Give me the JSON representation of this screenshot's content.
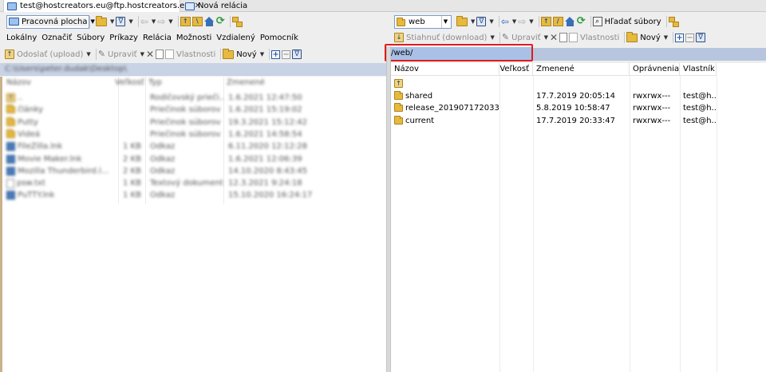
{
  "tabs": [
    {
      "label": "test@hostcreators.eu@ftp.hostcreators.eu",
      "close": "✕",
      "icon": "monitor-icon"
    },
    {
      "label": "Nová relácia",
      "icon": "new-session-icon"
    }
  ],
  "left_toolbar": {
    "location": "Pracovná plocha"
  },
  "menu": [
    "Lokálny",
    "Označiť",
    "Súbory",
    "Príkazy",
    "Relácia",
    "Možnosti",
    "Vzdialený",
    "Pomocník"
  ],
  "left_actions": {
    "upload": "Odoslať (upload)",
    "edit": "Upraviť",
    "properties": "Vlastnosti",
    "new": "Nový"
  },
  "right_toolbar": {
    "location": "web",
    "find_files": "Hľadať súbory"
  },
  "right_actions": {
    "download": "Stiahnuť (download)",
    "edit": "Upraviť",
    "properties": "Vlastnosti",
    "new": "Nový"
  },
  "left_panel": {
    "path": "C:\\Users\\peter.dudak\\Desktop\\",
    "columns": [
      "Názov",
      "Veľkosť",
      "Typ",
      "Zmenené"
    ],
    "rows": [
      {
        "name": "..",
        "size": "",
        "type": "Rodičovský prieči...",
        "modified": "1.6.2021  12:47:50",
        "icon": "updir"
      },
      {
        "name": "články",
        "size": "",
        "type": "Priečinok súborov",
        "modified": "1.6.2021  15:19:02",
        "icon": "folder"
      },
      {
        "name": "Putty",
        "size": "",
        "type": "Priečinok súborov",
        "modified": "19.3.2021  15:12:42",
        "icon": "folder"
      },
      {
        "name": "Videá",
        "size": "",
        "type": "Priečinok súborov",
        "modified": "1.6.2021  14:58:54",
        "icon": "folder"
      },
      {
        "name": "FileZilla.lnk",
        "size": "1 KB",
        "type": "Odkaz",
        "modified": "6.11.2020  12:12:28",
        "icon": "link"
      },
      {
        "name": "Movie Maker.lnk",
        "size": "2 KB",
        "type": "Odkaz",
        "modified": "1.6.2021  12:06:39",
        "icon": "link"
      },
      {
        "name": "Mozilla Thunderbird.l...",
        "size": "2 KB",
        "type": "Odkaz",
        "modified": "14.10.2020  8:43:45",
        "icon": "link"
      },
      {
        "name": "psw.txt",
        "size": "1 KB",
        "type": "Textový dokument",
        "modified": "12.3.2021  9:24:18",
        "icon": "doc"
      },
      {
        "name": "PuTTY.lnk",
        "size": "1 KB",
        "type": "Odkaz",
        "modified": "15.10.2020  16:24:17",
        "icon": "link"
      }
    ]
  },
  "right_panel": {
    "path": "/web/",
    "columns": [
      "Názov",
      "Veľkosť",
      "Zmenené",
      "Oprávnenia",
      "Vlastník"
    ],
    "rows": [
      {
        "name": "..",
        "size": "",
        "modified": "",
        "permissions": "",
        "owner": "",
        "icon": "updir"
      },
      {
        "name": "shared",
        "size": "",
        "modified": "17.7.2019 20:05:14",
        "permissions": "rwxrwx---",
        "owner": "test@h...",
        "icon": "folder"
      },
      {
        "name": "release_201907172033...",
        "size": "",
        "modified": "5.8.2019 10:58:47",
        "permissions": "rwxrwx---",
        "owner": "test@h...",
        "icon": "folder"
      },
      {
        "name": "current",
        "size": "",
        "modified": "17.7.2019 20:33:47",
        "permissions": "rwxrwx---",
        "owner": "test@h...",
        "icon": "folder"
      }
    ]
  },
  "colors": {
    "highlight_box": "#e01b1b",
    "path_field": "#a9c1e6",
    "folder": "#e6b93f"
  }
}
